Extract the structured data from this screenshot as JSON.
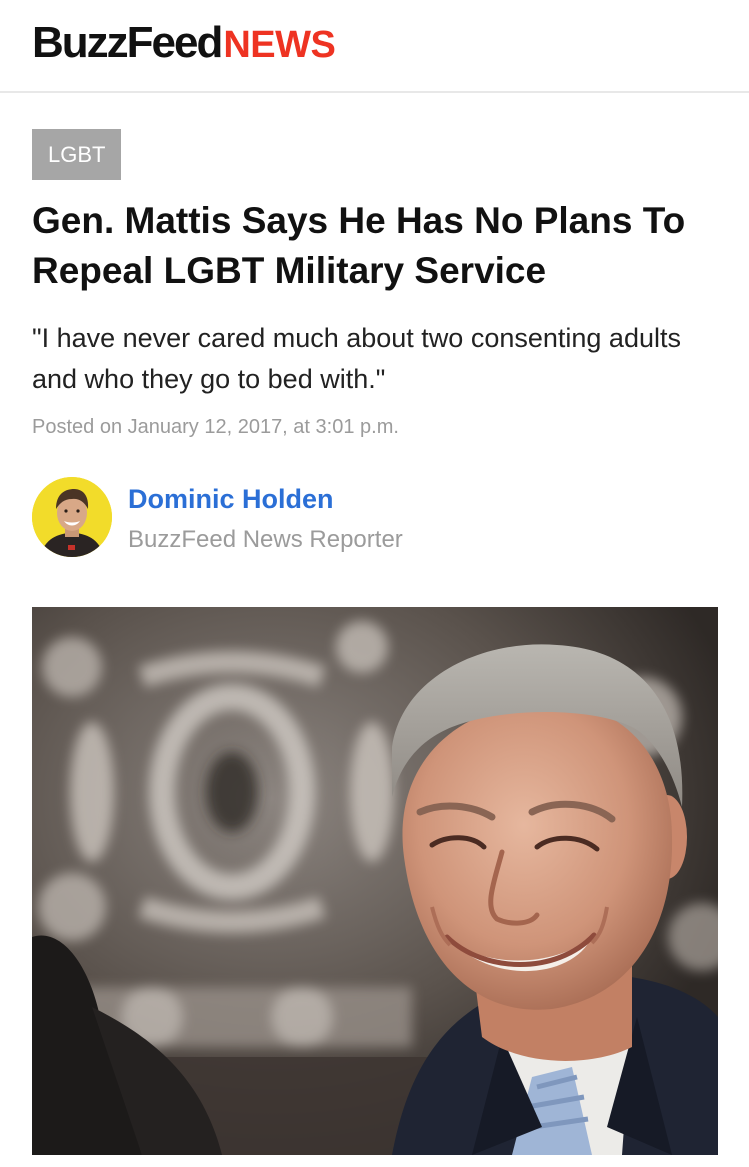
{
  "header": {
    "logo_buzz": "BuzzFeed",
    "logo_news": "NEWS"
  },
  "article": {
    "category": "LGBT",
    "headline": "Gen. Mattis Says He Has No Plans To Repeal LGBT Military Service",
    "dek": "\"I have never cared much about two consenting adults and who they go to bed with.\"",
    "posted": "Posted on January 12, 2017, at 3:01 p.m."
  },
  "byline": {
    "name": "Dominic Holden",
    "role": "BuzzFeed News Reporter"
  },
  "colors": {
    "news_red": "#ee3322",
    "author_blue": "#2b6fd6",
    "badge_gray": "#a6a6a6",
    "meta_gray": "#9b9b9b"
  }
}
